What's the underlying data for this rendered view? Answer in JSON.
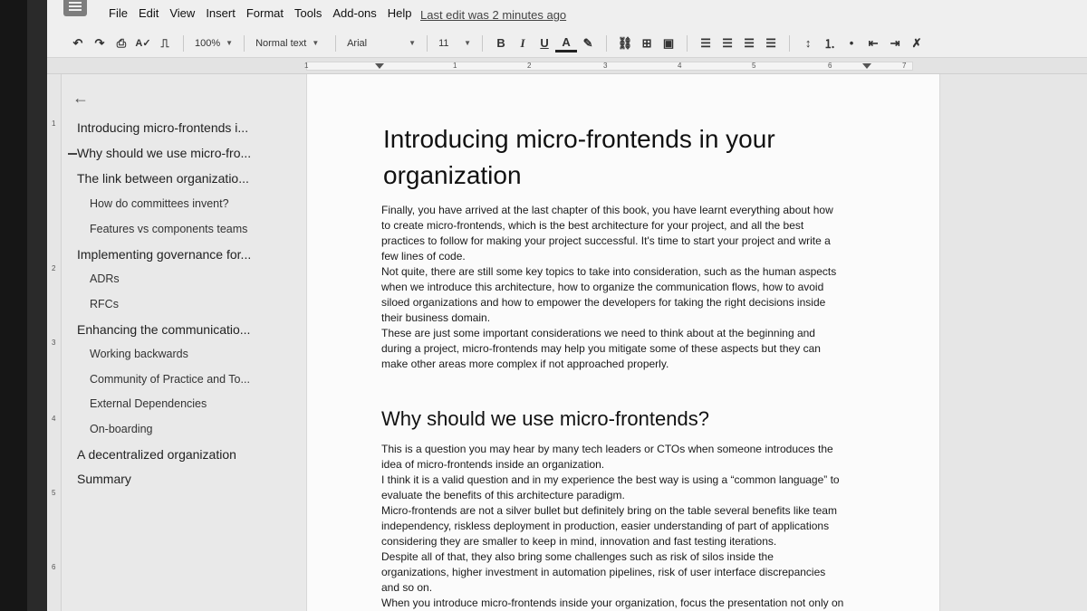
{
  "menu": {
    "items": [
      "File",
      "Edit",
      "View",
      "Insert",
      "Format",
      "Tools",
      "Add-ons",
      "Help"
    ],
    "last_edit": "Last edit was 2 minutes ago"
  },
  "toolbar": {
    "zoom": "100%",
    "style": "Normal text",
    "font": "Arial",
    "size": "11",
    "bold": "B",
    "italic": "I",
    "underline": "U",
    "text_color": "A"
  },
  "ruler": {
    "numbers": [
      "1",
      "1",
      "2",
      "3",
      "4",
      "5",
      "6",
      "7"
    ]
  },
  "vruler": {
    "numbers": [
      "1",
      "2",
      "3",
      "4",
      "5",
      "6"
    ]
  },
  "outline": {
    "items": [
      {
        "label": "Introducing micro-frontends i...",
        "level": 1
      },
      {
        "label": "Why should we use micro-fro...",
        "level": 1
      },
      {
        "label": "The link between organizatio...",
        "level": 1
      },
      {
        "label": "How do committees invent?",
        "level": 2
      },
      {
        "label": "Features vs components teams",
        "level": 2
      },
      {
        "label": "Implementing governance for...",
        "level": 1
      },
      {
        "label": "ADRs",
        "level": 2
      },
      {
        "label": "RFCs",
        "level": 2
      },
      {
        "label": "Enhancing the communicatio...",
        "level": 1
      },
      {
        "label": "Working backwards",
        "level": 2
      },
      {
        "label": "Community of Practice and To...",
        "level": 2
      },
      {
        "label": "External Dependencies",
        "level": 2
      },
      {
        "label": "On-boarding",
        "level": 2
      },
      {
        "label": "A decentralized organization",
        "level": 1
      },
      {
        "label": "Summary",
        "level": 1
      }
    ]
  },
  "document": {
    "title_line1": "Introducing micro-frontends in your",
    "title_line2": "organization",
    "intro": [
      "Finally, you have arrived at the last chapter of this book, you have learnt everything about how",
      "to create micro-frontends, which is the best architecture for your project, and all the best",
      "practices to follow for making your project successful. It's time to start your project and write a",
      "few lines of code.",
      "Not quite, there are still some key topics to take into consideration, such as the human aspects",
      "when we introduce this architecture, how to organize the communication flows, how to avoid",
      "siloed organizations and how to empower the developers for taking the right decisions inside",
      "their business domain.",
      "These are just some important considerations we need to think about at the beginning and",
      "during a project, micro-frontends may help you mitigate some of these aspects but they can",
      "make other areas more complex if not approached properly."
    ],
    "heading2": "Why should we use micro-frontends?",
    "section": [
      "This is a question you may hear by many tech leaders or CTOs when someone introduces the",
      "idea of micro-frontends inside an organization.",
      "I think it is a valid question and in my experience the best way is using a “common language” to",
      "evaluate the benefits of this architecture paradigm.",
      "Micro-frontends are not a silver bullet but definitely bring on the table several benefits like team",
      "independency, riskless deployment in production, easier understanding of part of applications",
      "considering they are smaller to keep in mind, innovation and fast testing iterations.",
      "Despite all of that, they also bring some challenges such as risk of silos inside the",
      "organizations, higher investment in automation pipelines, risk of user interface discrepancies",
      "and so on.",
      "When you introduce micro-frontends inside your organization, focus the presentation not only on"
    ]
  }
}
